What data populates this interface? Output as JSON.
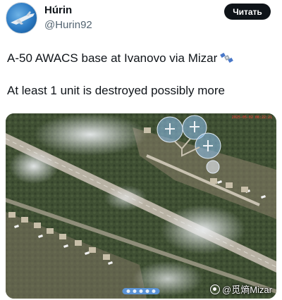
{
  "post": {
    "author": {
      "display_name": "Húrin",
      "handle": "@Hurin92"
    },
    "read_button_label": "Читать",
    "text_line1": "A-50 AWACS base at Ivanovo via Mizar",
    "text_line2": "At least 1 unit is destroyed possibly more",
    "emoji": "satellite-icon"
  },
  "media": {
    "description_icons": [
      "satellite-image"
    ],
    "timestamp_text": "2025-05-02 08:22:21",
    "watermark_text": "@觅熵Mizar",
    "pager_dots": 5
  },
  "colors": {
    "button_bg": "#0f1419",
    "handle_text": "#536471",
    "highlight_circle": "#8fc3f2",
    "timestamp": "#ff3b30"
  }
}
